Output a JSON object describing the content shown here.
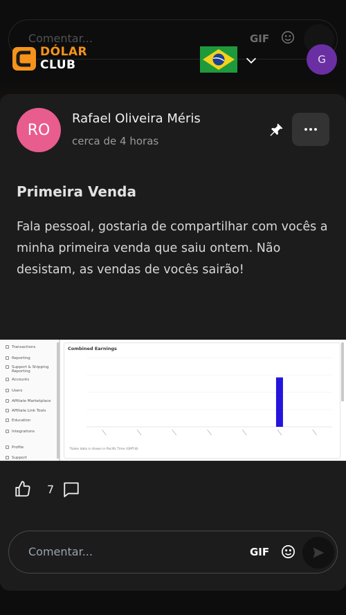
{
  "background_comment": {
    "placeholder": "Comentar...",
    "gif_label": "GIF"
  },
  "header": {
    "logo_top": "DÓLAR",
    "logo_bottom": "CLUB",
    "avatar_initial": "G",
    "accent_color": "#f7931a"
  },
  "post": {
    "author_initials": "RO",
    "author_name": "Rafael Oliveira Méris",
    "time": "cerca de 4 horas",
    "title": "Primeira Venda",
    "body": "Fala pessoal, gostaria de compartilhar com vocês a minha primeira venda que saiu ontem. Não desistam, as vendas de vocês sairão!",
    "likes": "7"
  },
  "attachment": {
    "sidebar_items": [
      "Transactions",
      "Reporting",
      "Support & Shipping",
      "Reporting",
      "Accounts",
      "Users",
      "Affiliate Marketplace",
      "Affiliate Link Tools",
      "Education",
      "Integrations",
      "Profile",
      "Support"
    ],
    "panel_title": "Combined Earnings",
    "footnote": "*Sales data is shown in Pacific Time (GMT-8)",
    "chart_data": {
      "type": "bar",
      "categories": [
        "1",
        "2",
        "3",
        "4",
        "5",
        "6",
        "7"
      ],
      "values": [
        0,
        0,
        0,
        0,
        0,
        100,
        0
      ],
      "ylim": [
        0,
        140
      ]
    }
  },
  "comment_bar": {
    "placeholder": "Comentar...",
    "gif_label": "GIF"
  }
}
